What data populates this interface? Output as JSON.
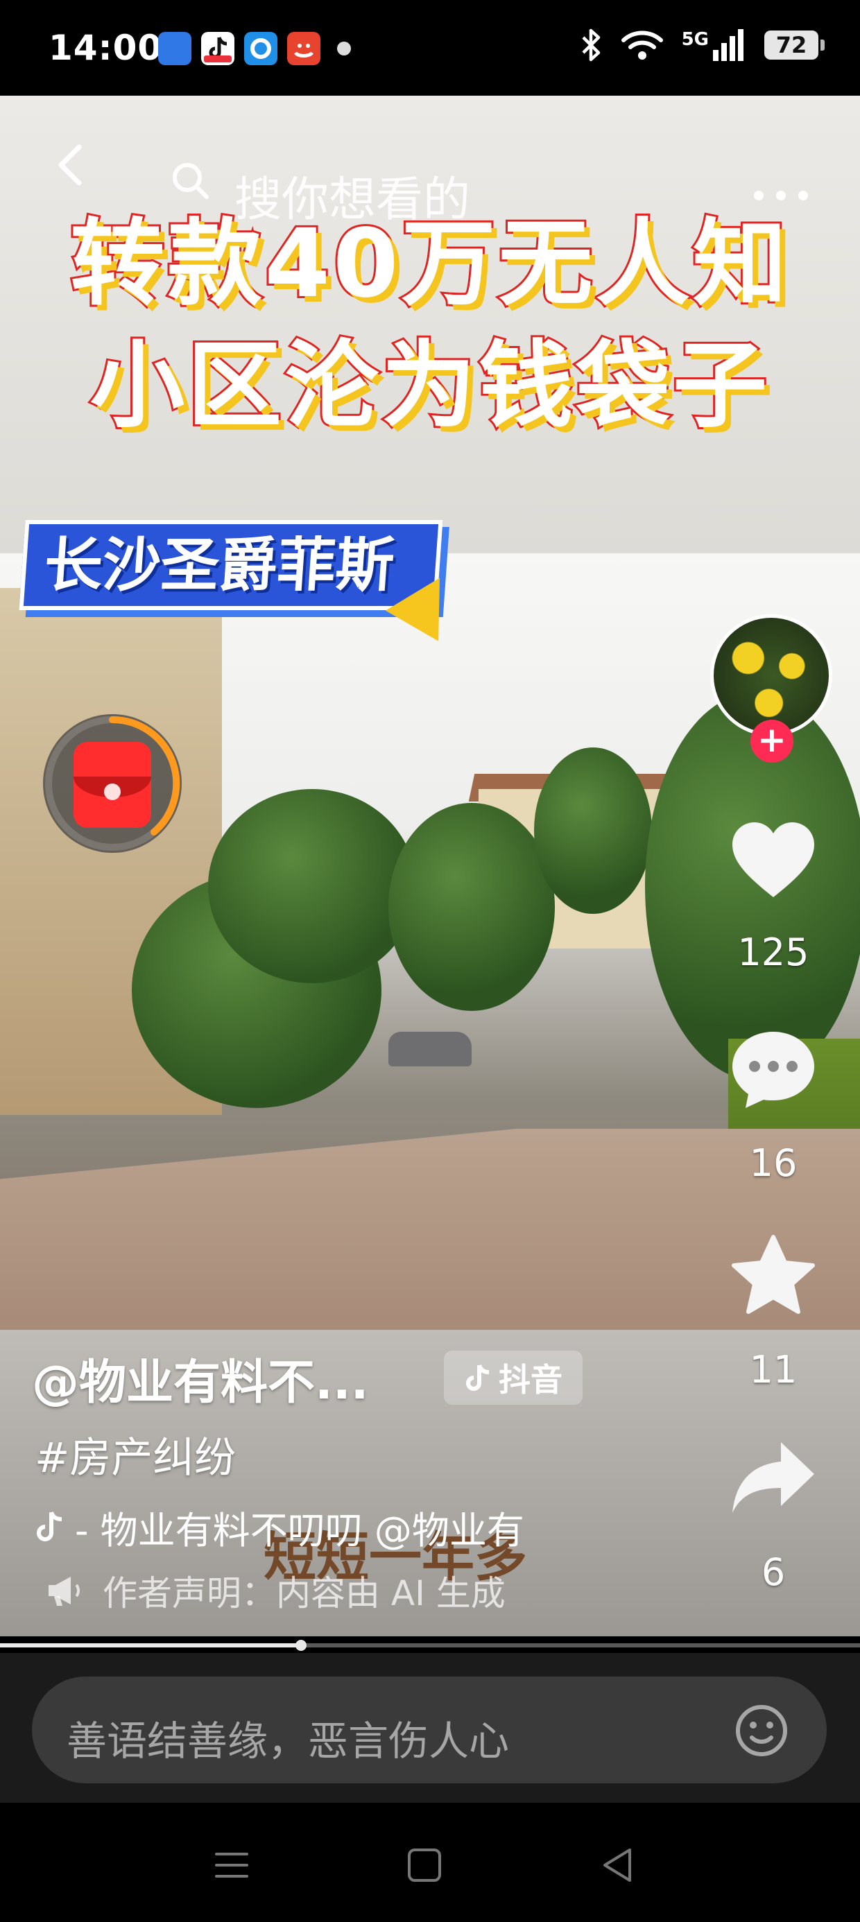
{
  "status_bar": {
    "time": "14:00",
    "network": "5G",
    "battery": "72",
    "app_icons": [
      "stocks-app-icon",
      "douyin-app-icon",
      "browser-app-icon",
      "shopping-app-icon"
    ]
  },
  "top_nav": {
    "search_placeholder": "搜你想看的"
  },
  "video": {
    "headline_line1": "转款40万无人知",
    "headline_line2": "小区沦为钱袋子",
    "location_tag": "长沙圣爵菲斯",
    "overlay_subtitle": "短短一年多",
    "progress": 0.35
  },
  "actions": {
    "like_count": "125",
    "comment_count": "16",
    "favorite_count": "11",
    "share_count": "6"
  },
  "info": {
    "author": "@物业有料不...",
    "platform_badge": "抖音",
    "hashtag": "#房产纠纷",
    "music": "- 物业有料不叨叨   @物业有",
    "ai_notice": "作者声明：内容由 AI 生成"
  },
  "comment_bar": {
    "placeholder": "善语结善缘，恶言伤人心"
  },
  "colors": {
    "follow_red": "#fe2c55",
    "headline_stroke": "#e02323",
    "tag_blue": "#2a55d8"
  }
}
